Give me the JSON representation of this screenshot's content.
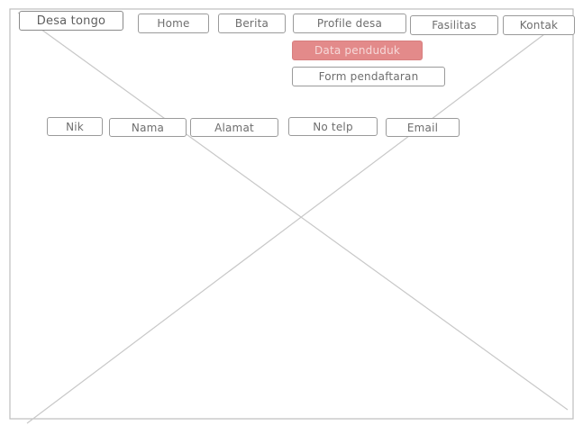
{
  "header": {
    "logo": "Desa tongo"
  },
  "nav": {
    "items": [
      {
        "id": "home",
        "label": "Home"
      },
      {
        "id": "berita",
        "label": "Berita"
      },
      {
        "id": "profile",
        "label": "Profile desa"
      },
      {
        "id": "fasilitas",
        "label": "Fasilitas"
      },
      {
        "id": "kontak",
        "label": "Kontak"
      }
    ],
    "dropdown": [
      {
        "id": "data-penduduk",
        "label": "Data penduduk",
        "active": true
      },
      {
        "id": "form-pendaftaran",
        "label": "Form pendaftaran",
        "active": false
      }
    ]
  },
  "table": {
    "columns": [
      "Nik",
      "Nama",
      "Alamat",
      "No telp",
      "Email"
    ]
  },
  "colors": {
    "border": "#9a9a9a",
    "text": "#6e6e6e",
    "highlight": "#e38a8a",
    "placeholder_lines": "#c8c8c8"
  }
}
